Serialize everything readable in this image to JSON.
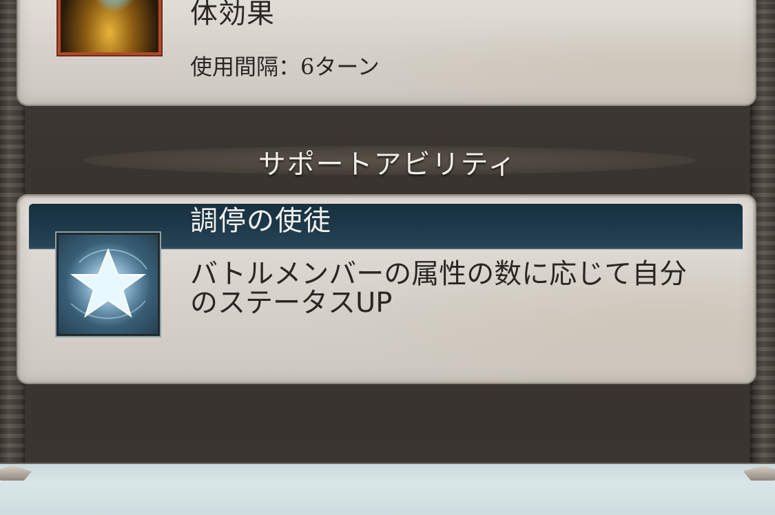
{
  "skill": {
    "description_visible": "体効果",
    "cooldown": "使用間隔：6ターン"
  },
  "support_section": {
    "title": "サポートアビリティ"
  },
  "ability": {
    "name": "調停の使徒",
    "description_line1": "バトルメンバーの属性の数に応じて自分",
    "description_line2": "のステータスUP",
    "icon": "star-icon"
  },
  "skill_icon": {
    "icon": "lightning-skill-icon"
  },
  "colors": {
    "name_bar": "#1f3b4c",
    "parchment": "#dcd8d1",
    "background": "#3b3632",
    "skill_icon_border": "#b24a2a"
  }
}
